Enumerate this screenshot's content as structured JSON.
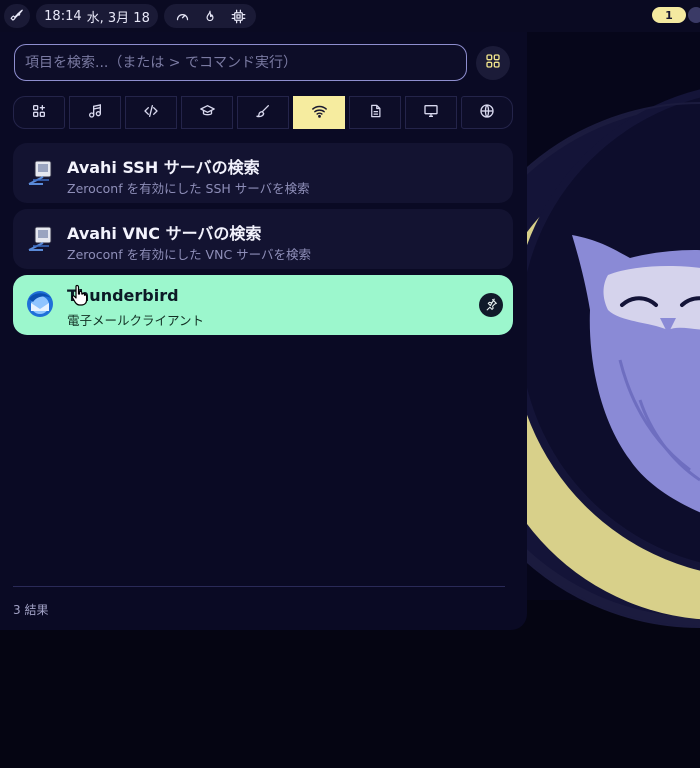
{
  "topbar": {
    "clock": "18:14",
    "date": "水, 3月 18",
    "workspace_number": "1",
    "icons": [
      "rocket-icon",
      "gauge-icon",
      "flame-icon",
      "cpu-icon"
    ]
  },
  "search": {
    "value": "",
    "placeholder": "項目を検索...（または > でコマンド実行）",
    "grid_button_icon": "apps-grid-icon"
  },
  "category_tabs": [
    {
      "name": "all-apps",
      "icon": "apps-plus-icon",
      "active": false
    },
    {
      "name": "audio",
      "icon": "music-note-icon",
      "active": false
    },
    {
      "name": "development",
      "icon": "code-icon",
      "active": false
    },
    {
      "name": "education",
      "icon": "graduation-cap-icon",
      "active": false
    },
    {
      "name": "graphics",
      "icon": "brush-icon",
      "active": false
    },
    {
      "name": "network",
      "icon": "wifi-icon",
      "active": true
    },
    {
      "name": "office",
      "icon": "document-icon",
      "active": false
    },
    {
      "name": "system",
      "icon": "monitor-icon",
      "active": false
    },
    {
      "name": "internet",
      "icon": "globe-icon",
      "active": false
    }
  ],
  "results": [
    {
      "title": "Avahi SSH サーバの検索",
      "subtitle": "Zeroconf を有効にした SSH サーバを検索",
      "icon": "network-server-icon",
      "selected": false
    },
    {
      "title": "Avahi VNC サーバの検索",
      "subtitle": "Zeroconf を有効にした VNC サーバを検索",
      "icon": "network-server-icon",
      "selected": false
    },
    {
      "title": "Thunderbird",
      "subtitle": "電子メールクライアント",
      "icon": "thunderbird-icon",
      "selected": true,
      "pin_icon": "pin-icon"
    }
  ],
  "result_count": "3 結果",
  "colors": {
    "background": "#0a0a24",
    "accent_selected": "#9cf7cd",
    "tab_active": "#f6ec9f",
    "owl_purple": "#8a8ad6",
    "moon_yellow": "#d8d08a"
  }
}
